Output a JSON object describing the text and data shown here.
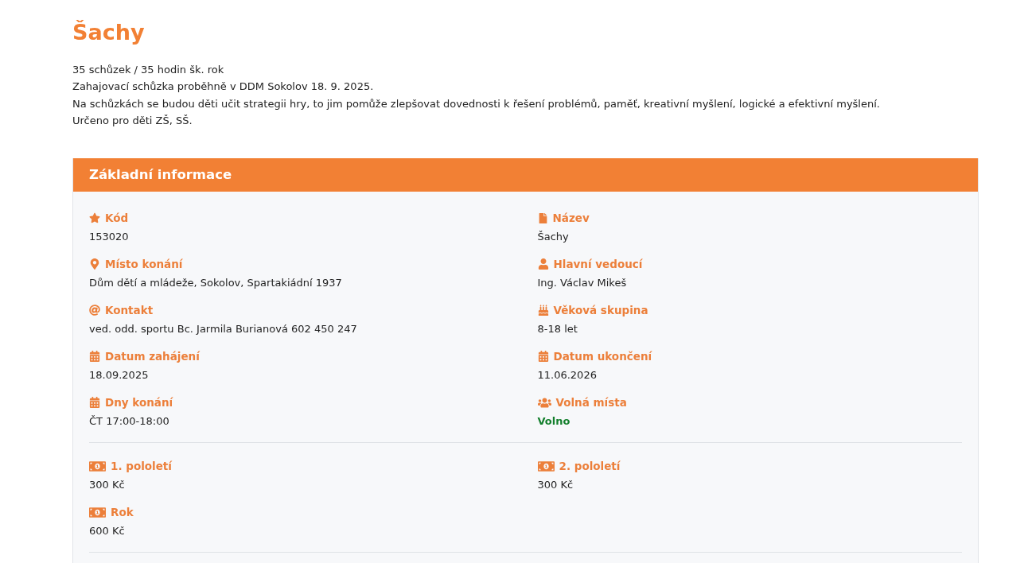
{
  "title": "Šachy",
  "description": [
    "35 schůzek / 35 hodin šk. rok",
    "Zahajovací schůzka proběhně v DDM Sokolov 18. 9. 2025.",
    "Na schůzkách se budou děti učit strategii hry, to jim pomůže zlepšovat dovednosti k řešení problémů, paměť, kreativní myšlení, logické a efektivní myšlení.",
    "Určeno pro děti ZŠ, SŠ."
  ],
  "info_card": {
    "title": "Základní informace",
    "sections": [
      {
        "fields": [
          {
            "label": "Kód",
            "value": "153020"
          },
          {
            "label": "Název",
            "value": "Šachy"
          },
          {
            "label": "Místo konání",
            "value": "Dům dětí a mládeže, Sokolov, Spartakiádní 1937"
          },
          {
            "label": "Hlavní vedoucí",
            "value": "Ing. Václav Mikeš"
          },
          {
            "label": "Kontakt",
            "value": "ved. odd. sportu Bc. Jarmila Burianová 602 450 247"
          },
          {
            "label": "Věková skupina",
            "value": "8-18 let"
          },
          {
            "label": "Datum zahájení",
            "value": "18.09.2025"
          },
          {
            "label": "Datum ukončení",
            "value": "11.06.2026"
          },
          {
            "label": "Dny konání",
            "value": "ČT 17:00-18:00"
          },
          {
            "label": "Volná místa",
            "value": "Volno",
            "color": "#137f2c"
          }
        ]
      },
      {
        "fields": [
          {
            "label": "1. pololetí",
            "value": "300 Kč"
          },
          {
            "label": "2. pololetí",
            "value": "300 Kč"
          },
          {
            "label": "Rok",
            "value": "600 Kč"
          }
        ]
      }
    ]
  }
}
